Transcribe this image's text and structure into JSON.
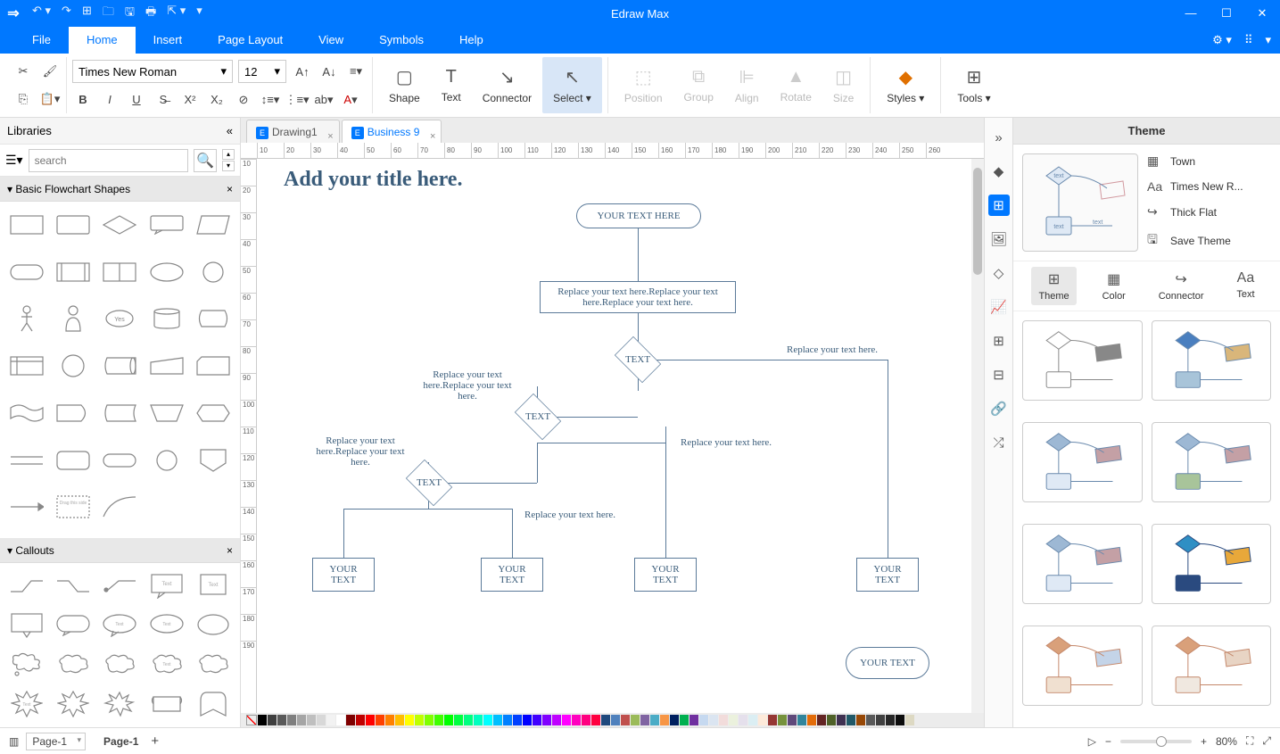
{
  "titlebar": {
    "app_title": "Edraw Max"
  },
  "menubar": {
    "items": [
      "File",
      "Home",
      "Insert",
      "Page Layout",
      "View",
      "Symbols",
      "Help"
    ],
    "active_index": 1
  },
  "ribbon": {
    "font_family": "Times New Roman",
    "font_size": "12",
    "tools": {
      "shape": "Shape",
      "text": "Text",
      "connector": "Connector",
      "select": "Select",
      "position": "Position",
      "group": "Group",
      "align": "Align",
      "rotate": "Rotate",
      "size": "Size",
      "styles": "Styles",
      "tools": "Tools"
    }
  },
  "libraries": {
    "title": "Libraries",
    "search_placeholder": "search",
    "sections": [
      "Basic Flowchart Shapes",
      "Callouts"
    ]
  },
  "tabs": [
    {
      "label": "Drawing1",
      "active": false
    },
    {
      "label": "Business 9",
      "active": true
    }
  ],
  "ruler_marks": [
    "10",
    "20",
    "30",
    "40",
    "50",
    "60",
    "70",
    "80",
    "90",
    "100",
    "110",
    "120",
    "130",
    "140",
    "150",
    "160",
    "170",
    "180",
    "190",
    "200",
    "210",
    "220",
    "230",
    "240",
    "250",
    "260"
  ],
  "ruler_marks_v": [
    "10",
    "20",
    "30",
    "40",
    "50",
    "60",
    "70",
    "80",
    "90",
    "100",
    "110",
    "120",
    "130",
    "140",
    "150",
    "160",
    "170",
    "180",
    "190"
  ],
  "flowchart": {
    "title": "Add your title here.",
    "terminator1": "YOUR TEXT HERE",
    "process1": "Replace your text here.Replace your text here.Replace your text here.",
    "decision1": "TEXT",
    "decision2": "TEXT",
    "decision3": "TEXT",
    "label_right1": "Replace your text here.",
    "label_left1": "Replace your text here.Replace your text here.",
    "label_right2": "Replace your text here.",
    "label_left2": "Replace your text here.Replace your text here.",
    "label_mid": "Replace your text here.",
    "box1": "YOUR TEXT",
    "box2": "YOUR TEXT",
    "box3": "YOUR TEXT",
    "box4": "YOUR TEXT",
    "terminator2": "YOUR TEXT"
  },
  "theme_panel": {
    "title": "Theme",
    "props": {
      "color_scheme": "Town",
      "font": "Times New R...",
      "connector": "Thick Flat",
      "save": "Save Theme"
    },
    "tabs": [
      "Theme",
      "Color",
      "Connector",
      "Text"
    ]
  },
  "statusbar": {
    "page_combo": "Page-1",
    "page_tab": "Page-1",
    "zoom": "80%"
  },
  "colors": [
    "#000000",
    "#3f3f3f",
    "#595959",
    "#7f7f7f",
    "#a5a5a5",
    "#bfbfbf",
    "#d8d8d8",
    "#f2f2f2",
    "#ffffff",
    "#7f0000",
    "#c00000",
    "#ff0000",
    "#ff4000",
    "#ff8000",
    "#ffbf00",
    "#ffff00",
    "#bfff00",
    "#80ff00",
    "#40ff00",
    "#00ff00",
    "#00ff40",
    "#00ff80",
    "#00ffbf",
    "#00ffff",
    "#00bfff",
    "#0080ff",
    "#0040ff",
    "#0000ff",
    "#4000ff",
    "#8000ff",
    "#bf00ff",
    "#ff00ff",
    "#ff00bf",
    "#ff0080",
    "#ff0040",
    "#1f497d",
    "#4f81bd",
    "#c0504d",
    "#9bbb59",
    "#8064a2",
    "#4bacc6",
    "#f79646",
    "#002060",
    "#00b050",
    "#7030a0",
    "#c6d9f0",
    "#dbe5f1",
    "#f2dcdb",
    "#ebf1dd",
    "#e5e0ec",
    "#dbeef3",
    "#fdeada",
    "#953734",
    "#76923c",
    "#5f497a",
    "#31859b",
    "#e36c09",
    "#632423",
    "#4f6128",
    "#3f3151",
    "#205867",
    "#974806",
    "#595959",
    "#404040",
    "#262626",
    "#0c0c0c",
    "#ddd9c3"
  ]
}
